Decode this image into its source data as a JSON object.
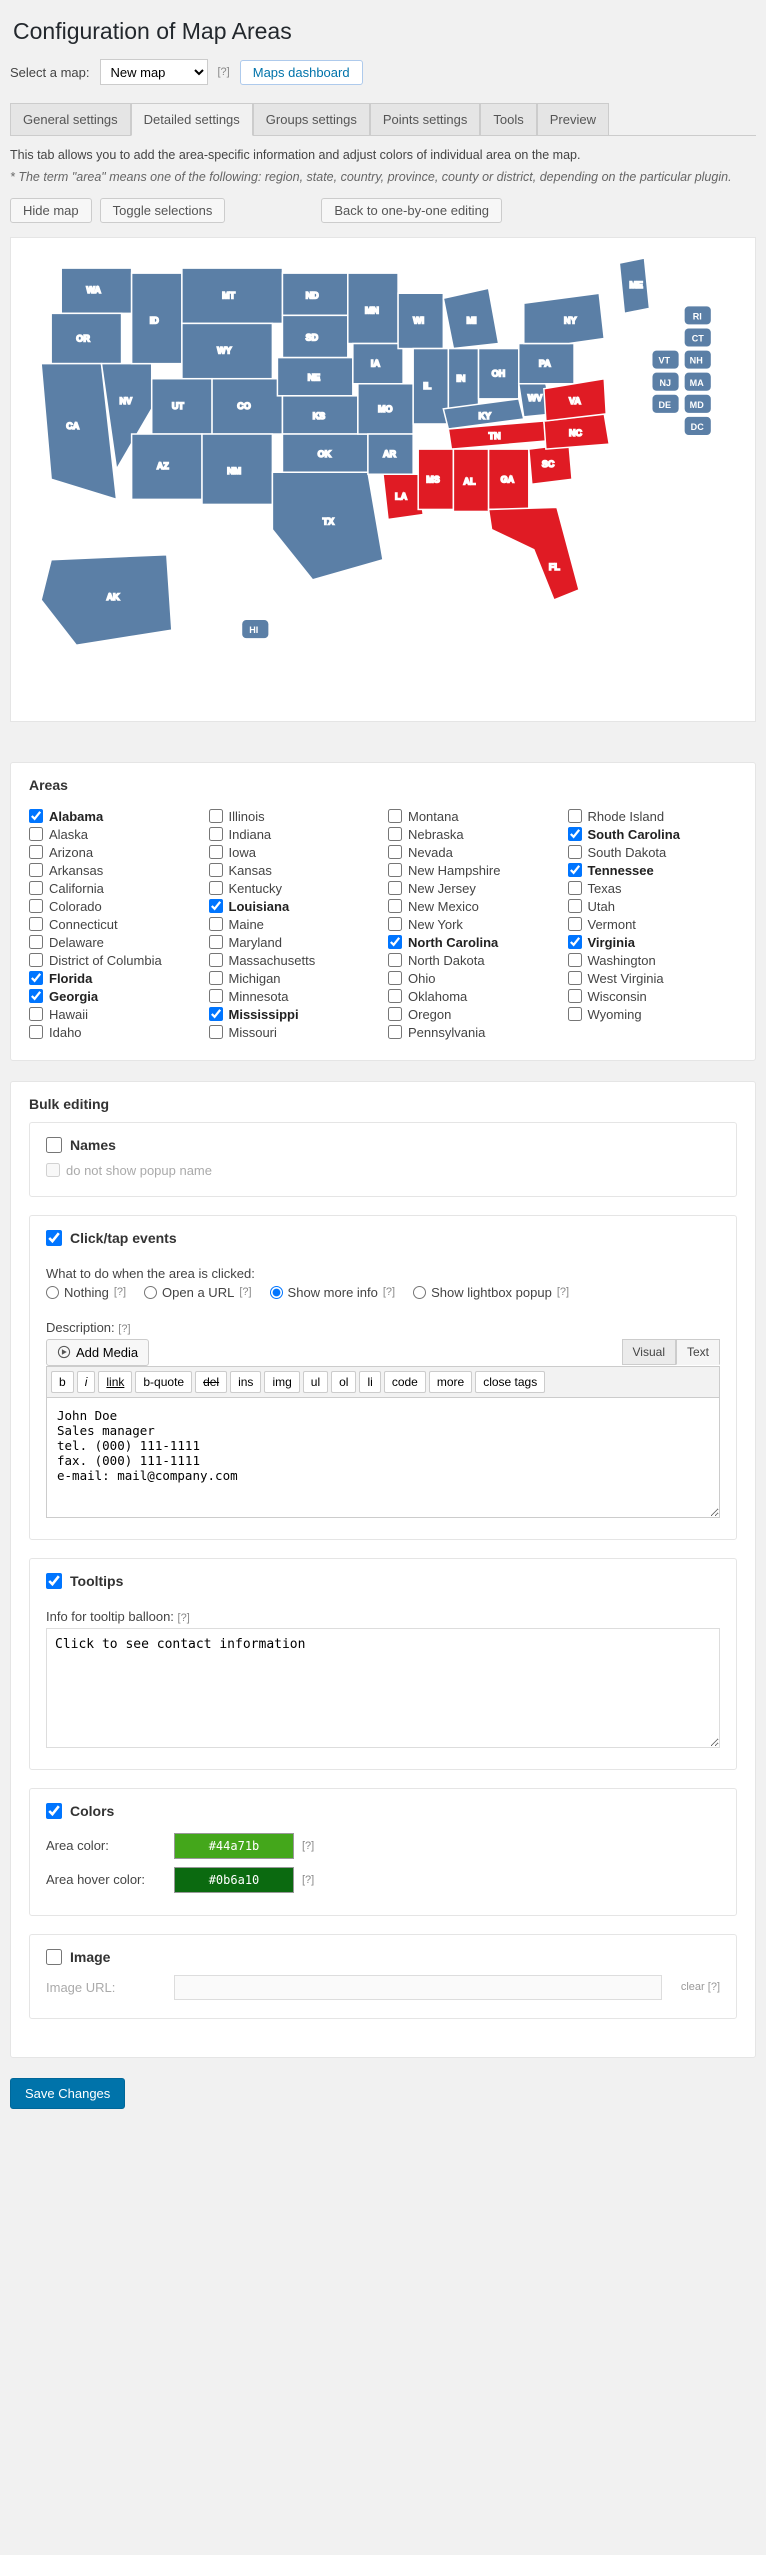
{
  "title": "Configuration of Map Areas",
  "topbar": {
    "select_label": "Select a map:",
    "select_value": "New map",
    "help": "[?]",
    "dashboard_btn": "Maps dashboard"
  },
  "tabs": {
    "general": "General settings",
    "detailed": "Detailed settings",
    "groups": "Groups settings",
    "points": "Points settings",
    "tools": "Tools",
    "preview": "Preview"
  },
  "intro": "This tab allows you to add the area-specific information and adjust colors of individual area on the map.",
  "note": "* The term \"area\" means one of the following: region, state, country, province, county or district, depending on the particular plugin.",
  "actions": {
    "hide_map": "Hide map",
    "toggle": "Toggle selections",
    "back": "Back to one-by-one editing"
  },
  "areas_heading": "Areas",
  "states": {
    "col1": [
      {
        "name": "Alabama",
        "sel": true
      },
      {
        "name": "Alaska",
        "sel": false
      },
      {
        "name": "Arizona",
        "sel": false
      },
      {
        "name": "Arkansas",
        "sel": false
      },
      {
        "name": "California",
        "sel": false
      },
      {
        "name": "Colorado",
        "sel": false
      },
      {
        "name": "Connecticut",
        "sel": false
      },
      {
        "name": "Delaware",
        "sel": false
      },
      {
        "name": "District of Columbia",
        "sel": false
      },
      {
        "name": "Florida",
        "sel": true
      },
      {
        "name": "Georgia",
        "sel": true
      },
      {
        "name": "Hawaii",
        "sel": false
      },
      {
        "name": "Idaho",
        "sel": false
      }
    ],
    "col2": [
      {
        "name": "Illinois",
        "sel": false
      },
      {
        "name": "Indiana",
        "sel": false
      },
      {
        "name": "Iowa",
        "sel": false
      },
      {
        "name": "Kansas",
        "sel": false
      },
      {
        "name": "Kentucky",
        "sel": false
      },
      {
        "name": "Louisiana",
        "sel": true
      },
      {
        "name": "Maine",
        "sel": false
      },
      {
        "name": "Maryland",
        "sel": false
      },
      {
        "name": "Massachusetts",
        "sel": false
      },
      {
        "name": "Michigan",
        "sel": false
      },
      {
        "name": "Minnesota",
        "sel": false
      },
      {
        "name": "Mississippi",
        "sel": true
      },
      {
        "name": "Missouri",
        "sel": false
      }
    ],
    "col3": [
      {
        "name": "Montana",
        "sel": false
      },
      {
        "name": "Nebraska",
        "sel": false
      },
      {
        "name": "Nevada",
        "sel": false
      },
      {
        "name": "New Hampshire",
        "sel": false
      },
      {
        "name": "New Jersey",
        "sel": false
      },
      {
        "name": "New Mexico",
        "sel": false
      },
      {
        "name": "New York",
        "sel": false
      },
      {
        "name": "North Carolina",
        "sel": true
      },
      {
        "name": "North Dakota",
        "sel": false
      },
      {
        "name": "Ohio",
        "sel": false
      },
      {
        "name": "Oklahoma",
        "sel": false
      },
      {
        "name": "Oregon",
        "sel": false
      },
      {
        "name": "Pennsylvania",
        "sel": false
      }
    ],
    "col4": [
      {
        "name": "Rhode Island",
        "sel": false
      },
      {
        "name": "South Carolina",
        "sel": true
      },
      {
        "name": "South Dakota",
        "sel": false
      },
      {
        "name": "Tennessee",
        "sel": true
      },
      {
        "name": "Texas",
        "sel": false
      },
      {
        "name": "Utah",
        "sel": false
      },
      {
        "name": "Vermont",
        "sel": false
      },
      {
        "name": "Virginia",
        "sel": true
      },
      {
        "name": "Washington",
        "sel": false
      },
      {
        "name": "West Virginia",
        "sel": false
      },
      {
        "name": "Wisconsin",
        "sel": false
      },
      {
        "name": "Wyoming",
        "sel": false
      }
    ]
  },
  "bulk_heading": "Bulk editing",
  "names_section": {
    "title": "Names",
    "sub": "do not show popup name"
  },
  "click_section": {
    "title": "Click/tap events",
    "prompt": "What to do when the area is clicked:",
    "opt_nothing": "Nothing",
    "opt_url": "Open a URL",
    "opt_more": "Show more info",
    "opt_lightbox": "Show lightbox popup",
    "desc_label": "Description:",
    "add_media": "Add Media",
    "visual": "Visual",
    "text": "Text",
    "qt": {
      "b": "b",
      "i": "i",
      "link": "link",
      "bq": "b-quote",
      "del": "del",
      "ins": "ins",
      "img": "img",
      "ul": "ul",
      "ol": "ol",
      "li": "li",
      "code": "code",
      "more": "more",
      "close": "close tags"
    },
    "content": "John Doe\nSales manager\ntel. (000) 111-1111\nfax. (000) 111-1111\ne-mail: mail@company.com"
  },
  "tooltips_section": {
    "title": "Tooltips",
    "label": "Info for tooltip balloon:",
    "content": "Click to see contact information"
  },
  "colors_section": {
    "title": "Colors",
    "area_label": "Area color:",
    "area_value": "#44a71b",
    "hover_label": "Area hover color:",
    "hover_value": "#0b6a10"
  },
  "image_section": {
    "title": "Image",
    "url_label": "Image URL:",
    "clear": "clear"
  },
  "save": "Save Changes",
  "help": "[?]",
  "map_labels": {
    "WA": "WA",
    "OR": "OR",
    "CA": "CA",
    "NV": "NV",
    "ID": "ID",
    "MT": "MT",
    "WY": "WY",
    "UT": "UT",
    "AZ": "AZ",
    "CO": "CO",
    "NM": "NM",
    "ND": "ND",
    "SD": "SD",
    "NE": "NE",
    "KS": "KS",
    "OK": "OK",
    "TX": "TX",
    "MN": "MN",
    "IA": "IA",
    "MO": "MO",
    "AR": "AR",
    "LA": "LA",
    "WI": "WI",
    "IL": "IL",
    "MI": "MI",
    "IN": "IN",
    "OH": "OH",
    "KY": "KY",
    "TN": "TN",
    "MS": "MS",
    "AL": "AL",
    "GA": "GA",
    "FL": "FL",
    "SC": "SC",
    "NC": "NC",
    "VA": "VA",
    "WV": "WV",
    "PA": "PA",
    "NY": "NY",
    "ME": "ME",
    "AK": "AK",
    "HI": "HI",
    "VT": "VT",
    "NH": "NH",
    "MA": "MA",
    "RI": "RI",
    "CT": "CT",
    "NJ": "NJ",
    "DE": "DE",
    "MD": "MD",
    "DC": "DC"
  }
}
